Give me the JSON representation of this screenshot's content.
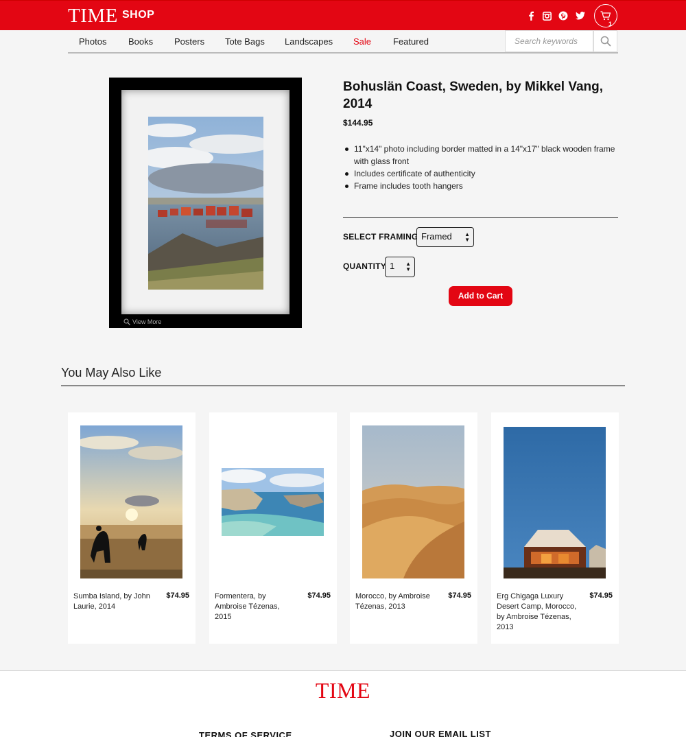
{
  "header": {
    "logo": "TIME",
    "shop_label": "SHOP",
    "social_icons": [
      "facebook-icon",
      "instagram-icon",
      "pinterest-icon",
      "twitter-icon"
    ],
    "cart_count": "1",
    "brand_color": "#e30613"
  },
  "nav": {
    "items": [
      "Photos",
      "Books",
      "Posters",
      "Tote Bags",
      "Landscapes",
      "Sale",
      "Featured"
    ],
    "search_placeholder": "Search keywords"
  },
  "product": {
    "title": "Bohuslän Coast, Sweden, by Mikkel Vang, 2014",
    "price": "$144.95",
    "features": [
      "11\"x14\" photo including border matted in a 14\"x17\" black wooden frame with glass front",
      "Includes certificate of authenticity",
      "Frame includes tooth hangers"
    ],
    "view_more": "View More",
    "framing_label": "SELECT FRAMING",
    "framing_value": "Framed",
    "quantity_label": "QUANTITY",
    "quantity_value": "1",
    "add_to_cart": "Add to Cart"
  },
  "related": {
    "title": "You May Also Like",
    "items": [
      {
        "name": "Sumba Island, by John Laurie, 2014",
        "price": "$74.95"
      },
      {
        "name": "Formentera, by Ambroise Tézenas, 2015",
        "price": "$74.95"
      },
      {
        "name": "Morocco, by Ambroise Tézenas, 2013",
        "price": "$74.95"
      },
      {
        "name": "Erg Chigaga Luxury Desert Camp, Morocco, by Ambroise Tézenas, 2013",
        "price": "$74.95"
      }
    ]
  },
  "footer": {
    "logo": "TIME",
    "terms": "TERMS OF SERVICE",
    "email": "JOIN OUR EMAIL LIST"
  }
}
